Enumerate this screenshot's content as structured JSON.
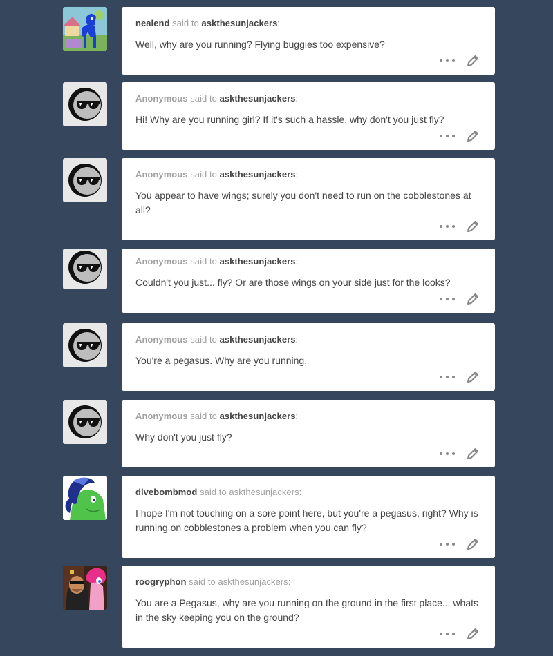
{
  "posts": [
    {
      "avatar": "pony-blue-avatar",
      "asker": "nealend",
      "said": "said to",
      "target": "askthesunjackers",
      "colon": ":",
      "question": "Well, why are you running? Flying buggies too expensive?",
      "style": "named"
    },
    {
      "avatar": "anonymous-sunglasses-avatar",
      "asker": "Anonymous",
      "said": "said to",
      "target": "askthesunjackers",
      "colon": ":",
      "question": "Hi! Why are you running girl? If it's such a hassle, why don't you just fly?",
      "style": "anon"
    },
    {
      "avatar": "anonymous-sunglasses-avatar",
      "asker": "Anonymous",
      "said": "said to",
      "target": "askthesunjackers",
      "colon": ":",
      "question": "You appear to have wings; surely you don't need to run on the cobblestones at all?",
      "style": "anon"
    },
    {
      "avatar": "anonymous-sunglasses-avatar",
      "asker": "Anonymous",
      "said": "said to",
      "target": "askthesunjackers",
      "colon": ":",
      "question": "Couldn't you just... fly? Or are those wings on your side just for the looks?",
      "style": "anon"
    },
    {
      "avatar": "anonymous-sunglasses-avatar",
      "asker": "Anonymous",
      "said": "said to",
      "target": "askthesunjackers",
      "colon": ":",
      "question": "You're a pegasus. Why are you running.",
      "style": "anon"
    },
    {
      "avatar": "anonymous-sunglasses-avatar",
      "asker": "Anonymous",
      "said": "said to",
      "target": "askthesunjackers",
      "colon": ":",
      "question": "Why don't you just fly?",
      "style": "anon"
    },
    {
      "avatar": "pony-green-avatar",
      "asker": "divebombmod",
      "said": "said to",
      "target": "askthesunjackers",
      "colon": ":",
      "question": "I hope I'm not touching on a sore point here, but you're a pegasus, right? Why is running on cobblestones a problem when you can fly?",
      "style": "named-plain"
    },
    {
      "avatar": "pinkie-pony-avatar",
      "asker": "roogryphon",
      "said": "said to",
      "target": "askthesunjackers",
      "colon": ":",
      "question": "You are a Pegasus, why are you running on the ground in the first place... whats in the sky keeping you on the ground?",
      "style": "named-plain"
    }
  ],
  "actions": {
    "more_icon": "ellipsis-icon",
    "edit_icon": "pencil-icon"
  },
  "colors": {
    "background": "#36465d",
    "card": "#ffffff",
    "text": "#444444",
    "muted": "#a0a0a0"
  }
}
